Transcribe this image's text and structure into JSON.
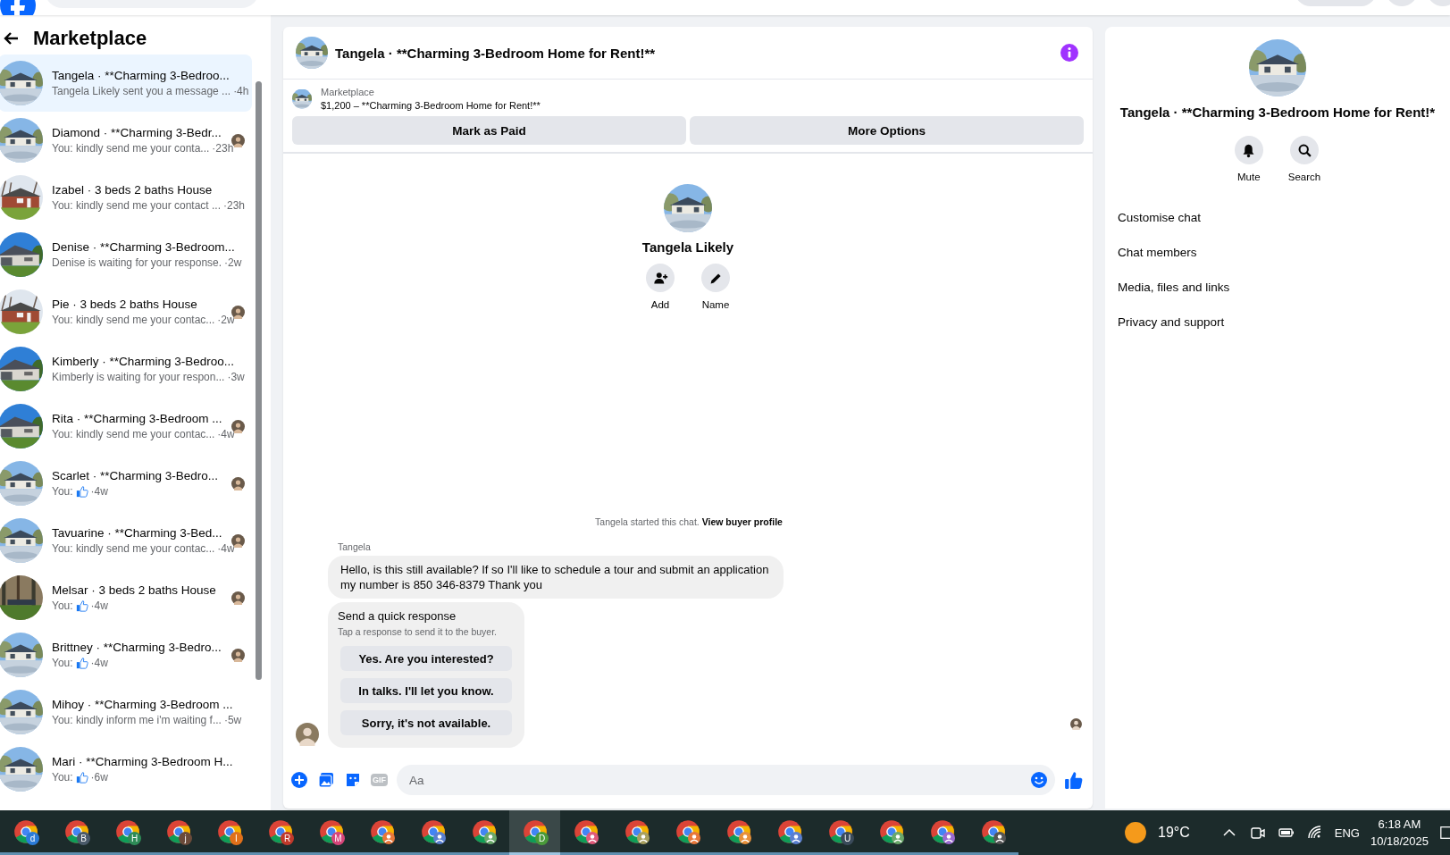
{
  "sidebar": {
    "title": "Marketplace",
    "conversations": [
      {
        "title": "Tangela · **Charming 3-Bedroo...",
        "preview": "Tangela Likely sent you a message ...",
        "like": false,
        "time": "·4h",
        "seen": false,
        "selected": true
      },
      {
        "title": "Diamond · **Charming 3-Bedr...",
        "preview": "You: kindly send me your conta...",
        "like": false,
        "time": "·23h",
        "seen": true,
        "selected": false
      },
      {
        "title": "Izabel · 3 beds 2 baths House",
        "preview": "You: kindly send me your contact ...",
        "like": false,
        "time": "·23h",
        "seen": false,
        "selected": false
      },
      {
        "title": "Denise · **Charming 3-Bedroom...",
        "preview": "Denise is waiting for your response.",
        "like": false,
        "time": "·2w",
        "seen": false,
        "selected": false
      },
      {
        "title": "Pie · 3 beds 2 baths House",
        "preview": "You: kindly send me your contac...",
        "like": false,
        "time": "·2w",
        "seen": true,
        "selected": false
      },
      {
        "title": "Kimberly · **Charming 3-Bedroo...",
        "preview": "Kimberly is waiting for your respon...",
        "like": false,
        "time": "·3w",
        "seen": false,
        "selected": false
      },
      {
        "title": "Rita · **Charming 3-Bedroom ...",
        "preview": "You: kindly send me your contac...",
        "like": false,
        "time": "·4w",
        "seen": true,
        "selected": false
      },
      {
        "title": "Scarlet · **Charming 3-Bedro...",
        "preview": "You:",
        "like": true,
        "time": "·4w",
        "seen": true,
        "selected": false
      },
      {
        "title": "Tavuarine · **Charming 3-Bed...",
        "preview": "You: kindly send me your contac...",
        "like": false,
        "time": "·4w",
        "seen": true,
        "selected": false
      },
      {
        "title": "Melsar · 3 beds 2 baths House",
        "preview": "You:",
        "like": true,
        "time": "·4w",
        "seen": true,
        "selected": false
      },
      {
        "title": "Brittney · **Charming 3-Bedro...",
        "preview": "You:",
        "like": true,
        "time": "·4w",
        "seen": true,
        "selected": false
      },
      {
        "title": "Mihoy · **Charming 3-Bedroom ...",
        "preview": "You: kindly inform me i'm waiting f...",
        "like": false,
        "time": "·5w",
        "seen": false,
        "selected": false
      },
      {
        "title": "Mari · **Charming 3-Bedroom H...",
        "preview": "You:",
        "like": true,
        "time": "·6w",
        "seen": false,
        "selected": false
      }
    ]
  },
  "chat": {
    "title": "Tangela · **Charming 3-Bedroom Home for Rent!**",
    "listing": {
      "label": "Marketplace",
      "text": "$1,200 – **Charming 3-Bedroom Home for Rent!**"
    },
    "buttons": [
      "Mark as Paid",
      "More Options"
    ],
    "profile": {
      "name": "Tangela Likely",
      "actions": [
        {
          "kind": "add",
          "label": "Add"
        },
        {
          "kind": "name",
          "label": "Name"
        }
      ]
    },
    "start_note": {
      "text": "Tangela started this chat.",
      "link": "View buyer profile"
    },
    "sender": "Tangela",
    "message": "Hello, is this still available? If so I'll like to schedule a tour and submit an application my number is 850 346-8379 Thank you",
    "quick_response": {
      "title": "Send a quick response",
      "subtitle": "Tap a response to send it to the buyer.",
      "options": [
        "Yes. Are you interested?",
        "In talks. I'll let you know.",
        "Sorry, it's not available."
      ]
    },
    "composer": {
      "gif": "GIF",
      "placeholder": "Aa"
    }
  },
  "info_panel": {
    "title": "Tangela · **Charming 3-Bedroom Home for Rent!*",
    "actions": [
      {
        "kind": "mute",
        "label": "Mute"
      },
      {
        "kind": "search",
        "label": "Search"
      }
    ],
    "menu": [
      "Customise chat",
      "Chat members",
      "Media, files and links",
      "Privacy and support"
    ]
  },
  "taskbar": {
    "apps": [
      {
        "badge": "d",
        "color": "#2b7bd8",
        "selected": false
      },
      {
        "badge": "B",
        "color": "#4a5a6a",
        "selected": false
      },
      {
        "badge": "H",
        "color": "#2e8b57",
        "selected": false
      },
      {
        "badge": "j",
        "color": "#6a4a3a",
        "selected": false
      },
      {
        "badge": "I",
        "color": "#e0701a",
        "selected": false
      },
      {
        "badge": "R",
        "color": "#c0392b",
        "selected": false
      },
      {
        "badge": "M",
        "color": "#d6457a",
        "selected": false
      },
      {
        "kind": "person",
        "color": "#e8773a",
        "selected": false
      },
      {
        "kind": "person",
        "color": "#5a7fd0",
        "selected": false
      },
      {
        "kind": "person",
        "color": "#6aa86a",
        "selected": false
      },
      {
        "badge": "D",
        "color": "#4a9a3a",
        "selected": true
      },
      {
        "kind": "person",
        "color": "#e05a7a",
        "selected": false
      },
      {
        "kind": "person",
        "color": "#a8a060",
        "selected": false
      },
      {
        "kind": "person",
        "color": "#e8773a",
        "selected": false
      },
      {
        "kind": "person",
        "color": "#e8903a",
        "selected": false
      },
      {
        "kind": "person",
        "color": "#5a7fd0",
        "selected": false
      },
      {
        "badge": "U",
        "color": "#3a4a5a",
        "selected": false
      },
      {
        "kind": "person",
        "color": "#6aa86a",
        "selected": false
      },
      {
        "kind": "person",
        "color": "#9a6ad0",
        "selected": false
      },
      {
        "kind": "person",
        "color": "#555555",
        "selected": false
      }
    ],
    "temperature": "19°C",
    "language": "ENG",
    "time": "6:18 AM",
    "date": "10/18/2025"
  }
}
